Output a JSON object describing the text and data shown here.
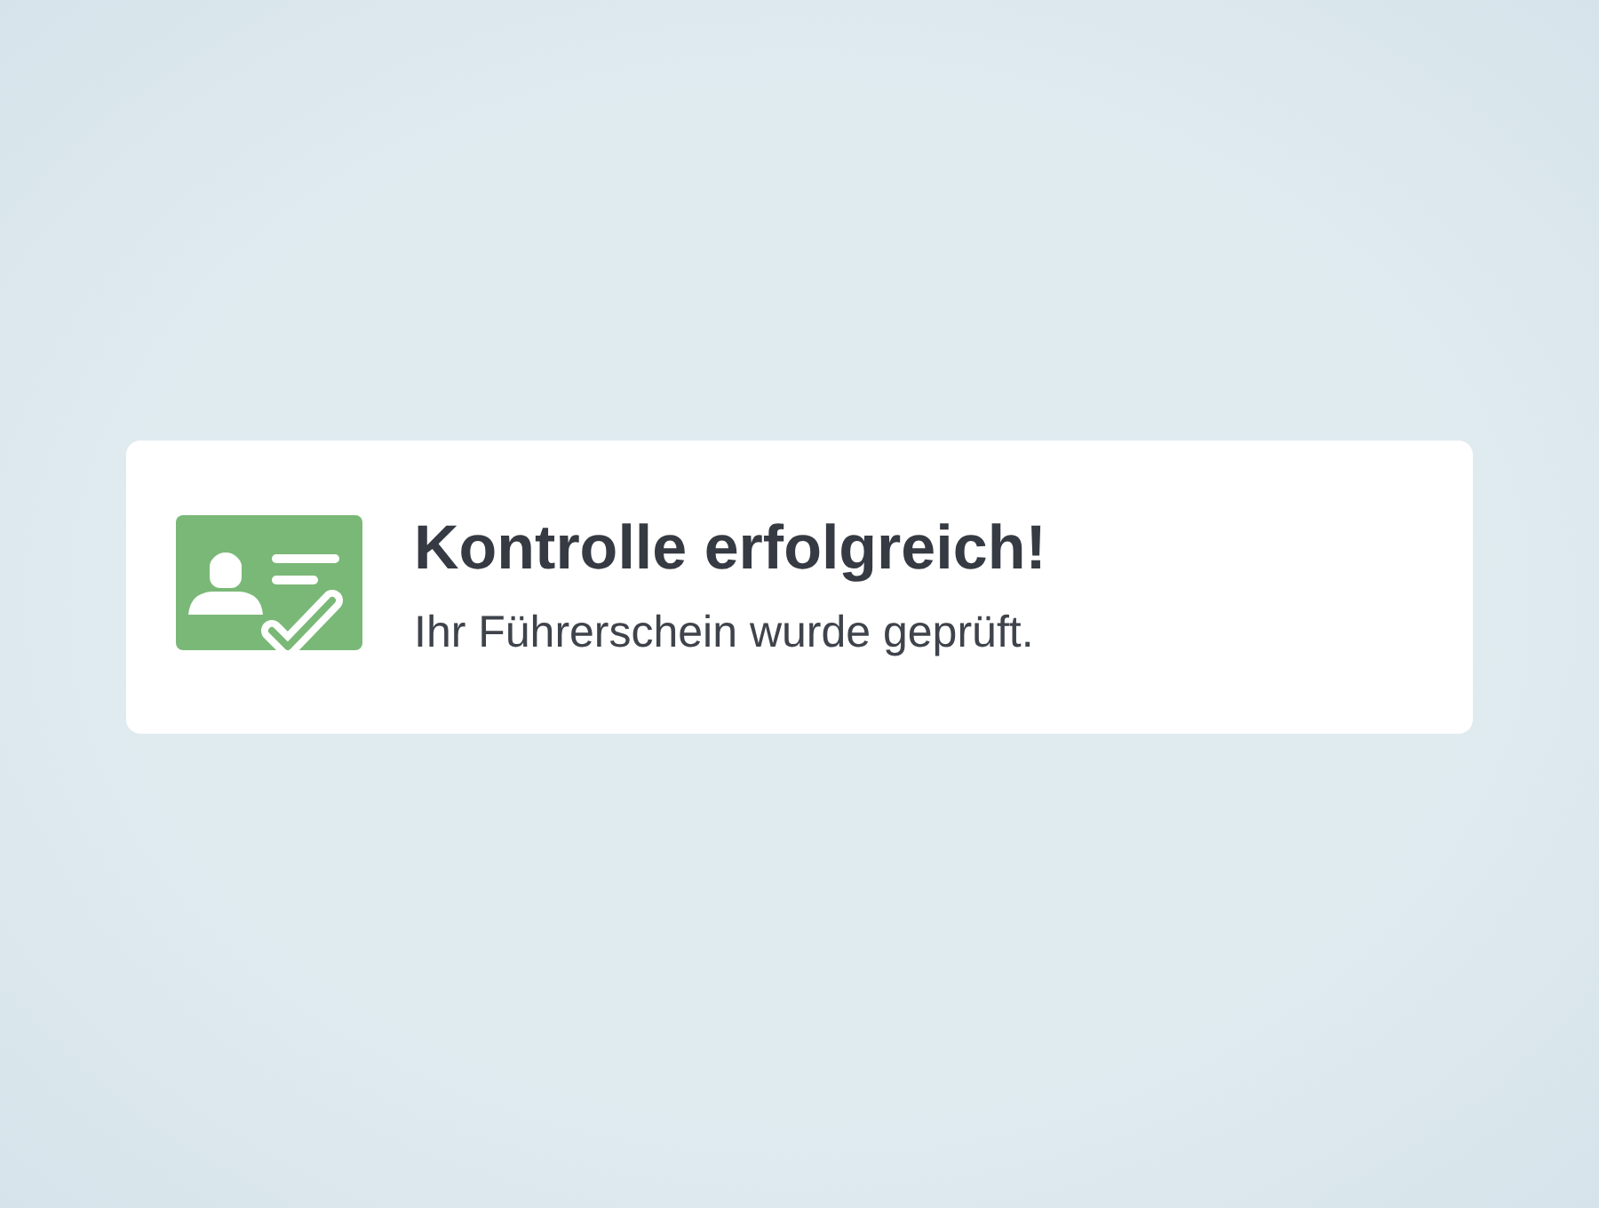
{
  "notification": {
    "title": "Kontrolle erfolgreich!",
    "message": "Ihr Führerschein wurde geprüft."
  }
}
